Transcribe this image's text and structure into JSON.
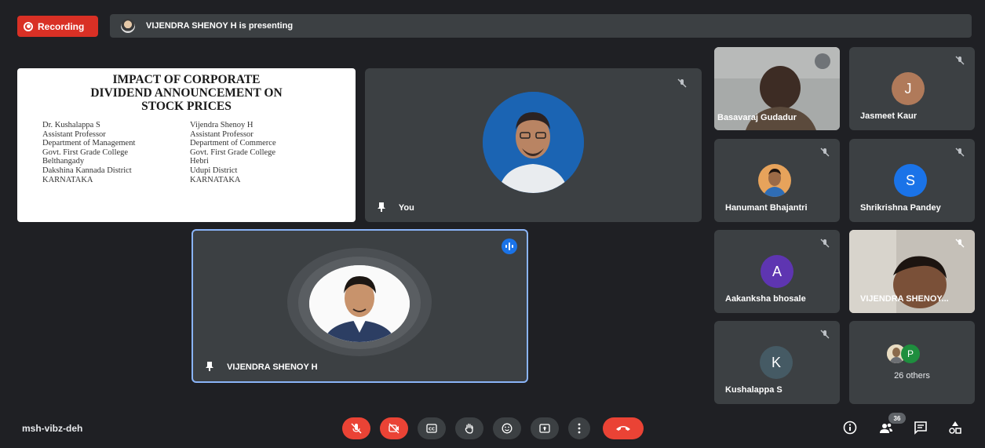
{
  "topbar": {
    "recording_label": "Recording",
    "presenting_text": "VIJENDRA SHENOY H is presenting"
  },
  "slide": {
    "title_lines": [
      "IMPACT OF CORPORATE",
      "DIVIDEND ANNOUNCEMENT ON",
      "STOCK PRICES"
    ],
    "left_col": [
      "Dr. Kushalappa S",
      "Assistant Professor",
      "Department of Management",
      "Govt. First Grade College",
      "Belthangady",
      "Dakshina Kannada District",
      "KARNATAKA"
    ],
    "right_col": [
      "Vijendra Shenoy H",
      "Assistant Professor",
      "Department of Commerce",
      "Govt. First Grade College",
      "Hebri",
      "Udupi District",
      "KARNATAKA"
    ]
  },
  "tiles": {
    "you": {
      "name": "You"
    },
    "speaker": {
      "name": "VIJENDRA SHENOY H"
    },
    "basavaraj": {
      "name": "Basavaraj Gudadur"
    },
    "jasmeet": {
      "name": "Jasmeet Kaur",
      "initial": "J",
      "color": "#b07a5a"
    },
    "hanumant": {
      "name": "Hanumant Bhajantri"
    },
    "shrikrishna": {
      "name": "Shrikrishna Pandey",
      "initial": "S",
      "color": "#1a73e8"
    },
    "aakanksha": {
      "name": "Aakanksha bhosale",
      "initial": "A",
      "color": "#5e35b1"
    },
    "vijendra_cam": {
      "name": "VIJENDRA SHENOY..."
    },
    "kushalappa": {
      "name": "Kushalappa S",
      "initial": "K",
      "color": "#455a64"
    },
    "others": {
      "label": "26 others",
      "initial": "P",
      "color": "#1e8e3e"
    }
  },
  "bottombar": {
    "meeting_code": "msh-vibz-deh",
    "participant_count": "36"
  },
  "colors": {
    "accent": "#8ab4f8",
    "danger": "#ea4335"
  }
}
